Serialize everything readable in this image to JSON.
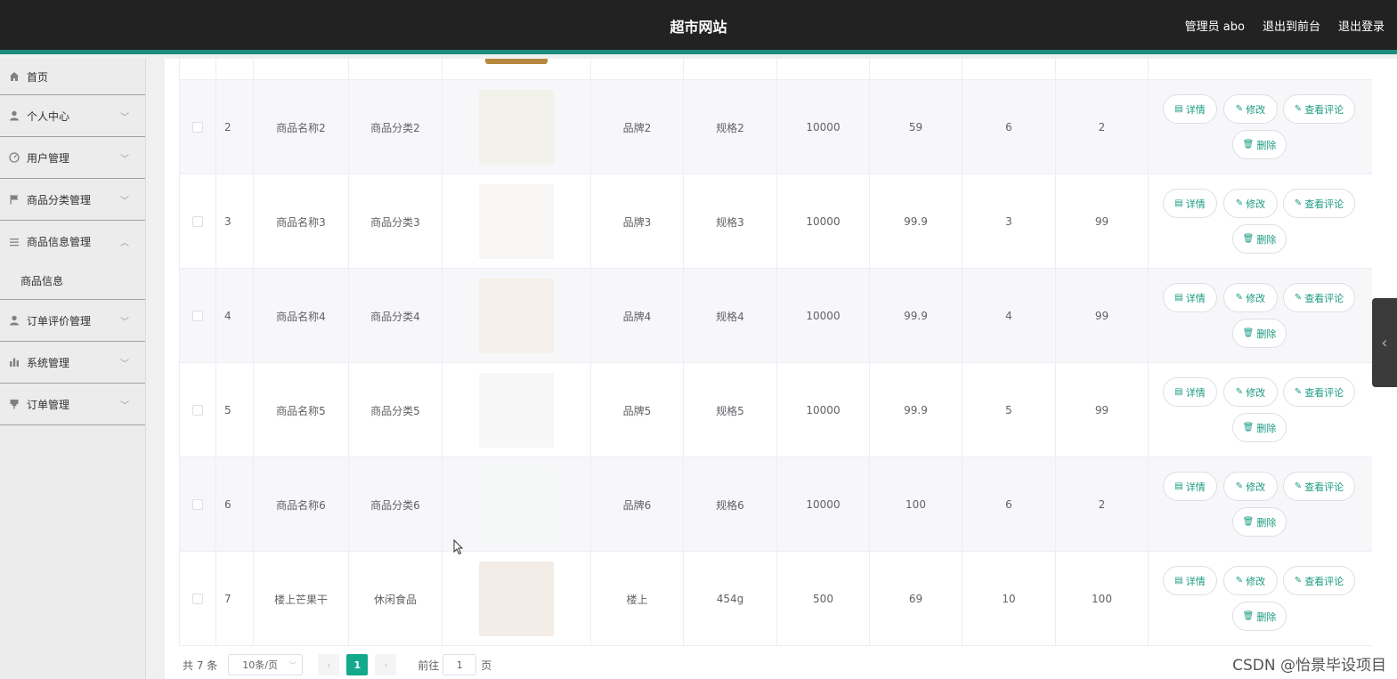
{
  "header": {
    "title": "超市网站",
    "admin_label": "管理员 abo",
    "front_label": "退出到前台",
    "logout_label": "退出登录"
  },
  "sidebar": {
    "items": [
      {
        "label": "首页",
        "icon": "home-icon"
      },
      {
        "label": "个人中心",
        "icon": "user-icon"
      },
      {
        "label": "用户管理",
        "icon": "dashboard-icon"
      },
      {
        "label": "商品分类管理",
        "icon": "flag-icon"
      },
      {
        "label": "商品信息管理",
        "icon": "list-icon",
        "sub": "商品信息"
      },
      {
        "label": "订单评价管理",
        "icon": "user-icon"
      },
      {
        "label": "系统管理",
        "icon": "chart-icon"
      },
      {
        "label": "订单管理",
        "icon": "pin-icon"
      }
    ]
  },
  "table": {
    "rows": [
      {
        "id": "2",
        "name": "商品名称2",
        "category": "商品分类2",
        "image": "food-image",
        "brand": "品牌2",
        "spec": "规格2",
        "stock": "10000",
        "price": "59",
        "col9": "6",
        "col10": "2"
      },
      {
        "id": "3",
        "name": "商品名称3",
        "category": "商品分类3",
        "image": "pet-cage-image",
        "brand": "品牌3",
        "spec": "规格3",
        "stock": "10000",
        "price": "99.9",
        "col9": "3",
        "col10": "99"
      },
      {
        "id": "4",
        "name": "商品名称4",
        "category": "商品分类4",
        "image": "pet-food-bag-image",
        "brand": "品牌4",
        "spec": "规格4",
        "stock": "10000",
        "price": "99.9",
        "col9": "4",
        "col10": "99"
      },
      {
        "id": "5",
        "name": "商品名称5",
        "category": "商品分类5",
        "image": "hair-dryer-white-image",
        "brand": "品牌5",
        "spec": "规格5",
        "stock": "10000",
        "price": "99.9",
        "col9": "5",
        "col10": "99"
      },
      {
        "id": "6",
        "name": "商品名称6",
        "category": "商品分类6",
        "image": "hair-dryer-green-image",
        "brand": "品牌6",
        "spec": "规格6",
        "stock": "10000",
        "price": "100",
        "col9": "6",
        "col10": "2"
      },
      {
        "id": "7",
        "name": "楼上芒果干",
        "category": "休闲食品",
        "image": "dried-mango-image",
        "brand": "楼上",
        "spec": "454g",
        "stock": "500",
        "price": "69",
        "col9": "10",
        "col10": "100"
      }
    ],
    "actions": {
      "detail": "详情",
      "edit": "修改",
      "comments": "查看评论",
      "delete": "删除"
    }
  },
  "pagination": {
    "total": "共 7 条",
    "page_size": "10条/页",
    "current_page": "1",
    "goto_label": "前往",
    "goto_value": "1",
    "page_suffix": "页"
  },
  "watermark": "CSDN @怡景毕设项目",
  "colors": {
    "accent": "#1b9b82",
    "topbar": "#222222",
    "topbar_border": "#1c8c7d"
  }
}
